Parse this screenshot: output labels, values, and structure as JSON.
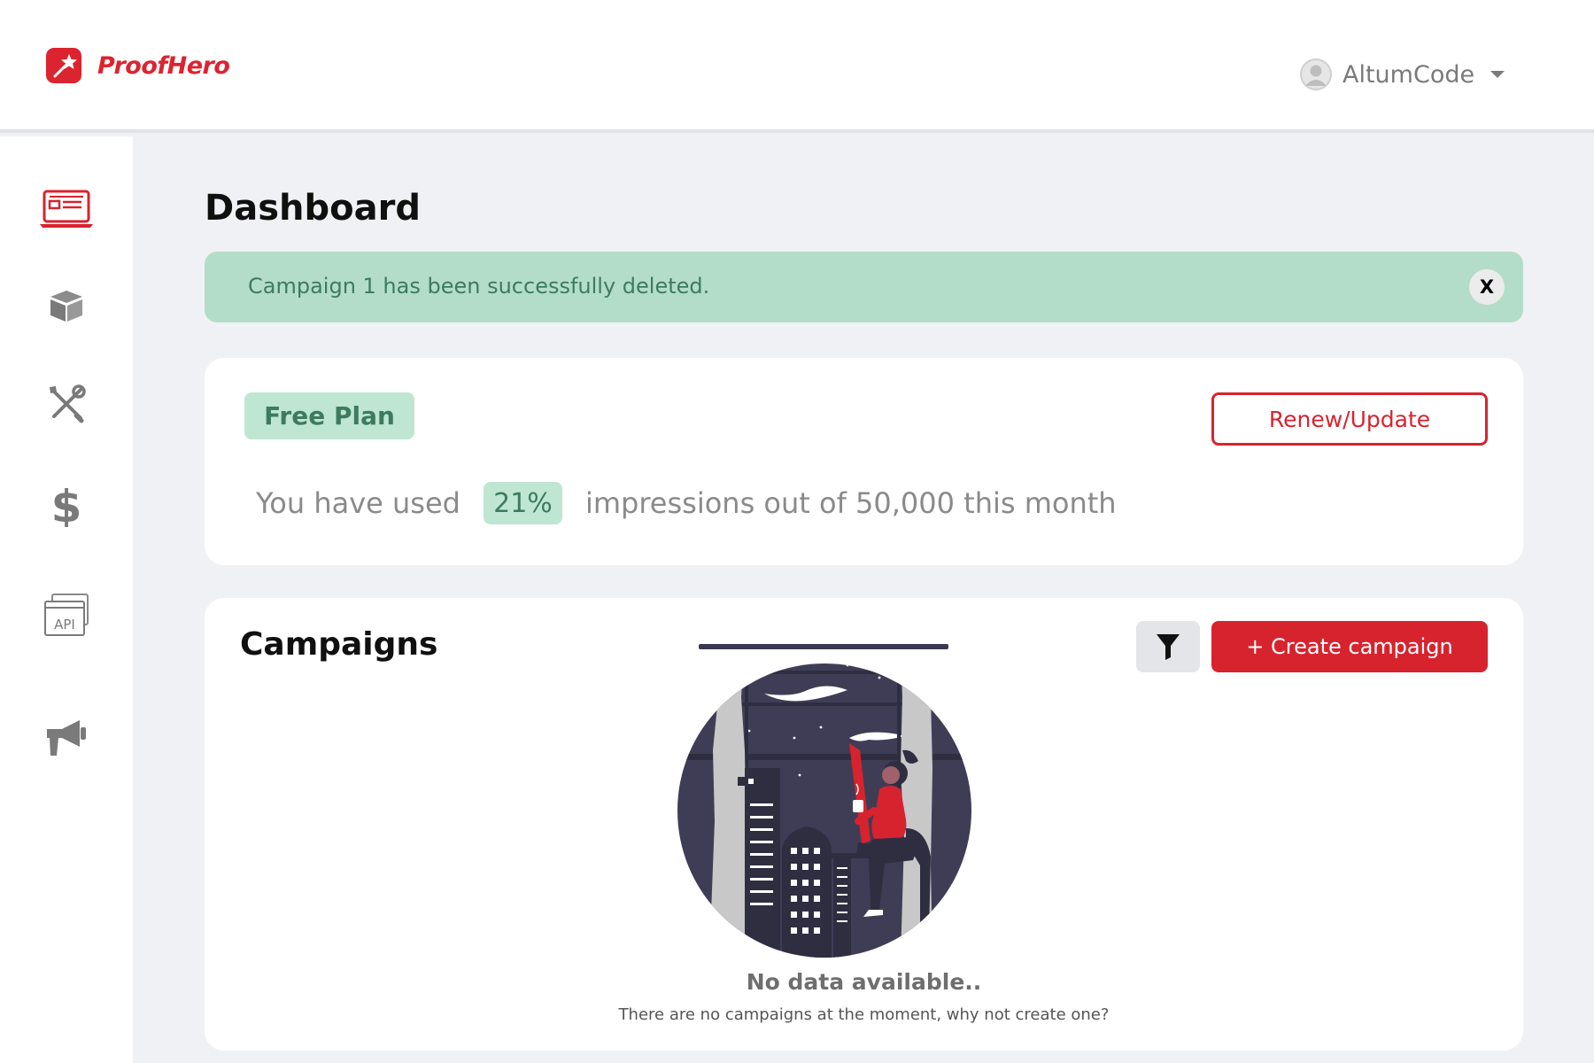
{
  "brand": {
    "name": "ProofHero",
    "color": "#dc2430"
  },
  "user": {
    "name": "AltumCode"
  },
  "sidebar": {
    "items": [
      {
        "icon": "dashboard-icon",
        "active": true
      },
      {
        "icon": "package-icon",
        "active": false
      },
      {
        "icon": "tools-icon",
        "active": false
      },
      {
        "icon": "dollar-icon",
        "active": false
      },
      {
        "icon": "api-icon",
        "active": false
      },
      {
        "icon": "megaphone-icon",
        "active": false
      }
    ]
  },
  "page": {
    "title": "Dashboard"
  },
  "alert": {
    "message": "Campaign 1 has been successfully deleted.",
    "close_label": "X"
  },
  "plan": {
    "name": "Free Plan",
    "renew_label": "Renew/Update",
    "usage_prefix": "You have used",
    "usage_percent": "21%",
    "usage_suffix": "impressions out of 50,000 this month"
  },
  "campaigns": {
    "title": "Campaigns",
    "create_label": "+ Create campaign",
    "empty_title": "No data available..",
    "empty_subtitle": "There are no campaigns at the moment, why not create one?"
  },
  "colors": {
    "accent": "#d7232e",
    "success_bg": "#b4ddc9",
    "success_text": "#3d7b5f",
    "icon_gray": "#808080"
  }
}
